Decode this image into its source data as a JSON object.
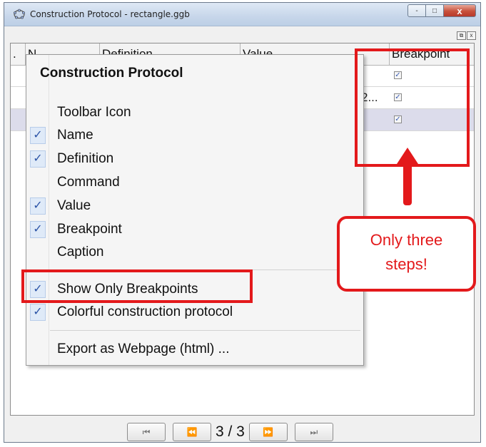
{
  "window": {
    "title": "Construction Protocol - rectangle.ggb",
    "close_glyph": "x",
    "minimize_glyph": "-",
    "maximize_glyph": "□"
  },
  "toolstrip": {
    "undock_glyph": "⧉",
    "close_glyph": "x"
  },
  "table": {
    "headers": [
      ".",
      "N",
      "Definition",
      "Value",
      "Breakpoint"
    ],
    "rows": [
      {
        "value": "",
        "breakpoint": true,
        "highlighted": false
      },
      {
        "value": "2...",
        "breakpoint": true,
        "highlighted": false
      },
      {
        "value": "",
        "breakpoint": true,
        "highlighted": true
      }
    ]
  },
  "menu": {
    "title": "Construction Protocol",
    "items": [
      {
        "label": "Toolbar Icon",
        "checked": false
      },
      {
        "label": "Name",
        "checked": true
      },
      {
        "label": "Definition",
        "checked": true
      },
      {
        "label": "Command",
        "checked": false
      },
      {
        "label": "Value",
        "checked": true
      },
      {
        "label": "Breakpoint",
        "checked": true
      },
      {
        "label": "Caption",
        "checked": false
      },
      {
        "label": "Show Only Breakpoints",
        "checked": true
      },
      {
        "label": "Colorful construction protocol",
        "checked": true
      },
      {
        "label": "Export as Webpage (html) ...",
        "checked": false
      }
    ],
    "check_glyph": "✓"
  },
  "navigation": {
    "first_glyph": "⏮",
    "prev_glyph": "⏪",
    "next_glyph": "⏩",
    "last_glyph": "⏭",
    "step_text": "3 / 3"
  },
  "annotation": {
    "callout_line1": "Only three",
    "callout_line2": "steps!",
    "accent_color": "#e3191b"
  }
}
